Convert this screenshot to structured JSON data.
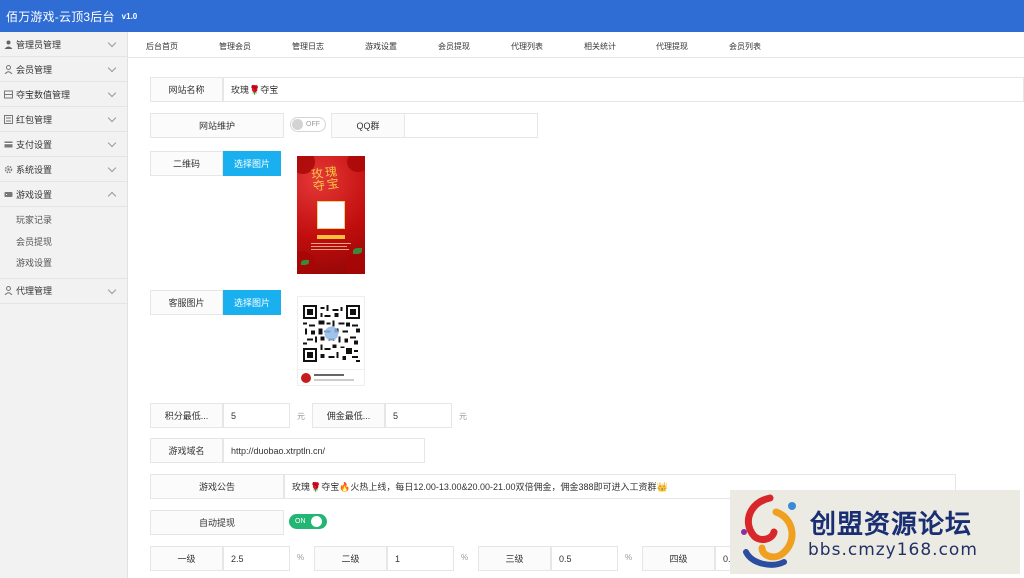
{
  "app": {
    "title": "佰万游戏-云顶3后台",
    "version": "v1.0"
  },
  "sidebar": {
    "items": [
      {
        "label": "管理员管理",
        "icon": "user-icon"
      },
      {
        "label": "会员管理",
        "icon": "person-icon"
      },
      {
        "label": "夺宝数值管理",
        "icon": "database-icon"
      },
      {
        "label": "红包管理",
        "icon": "list-icon"
      },
      {
        "label": "支付设置",
        "icon": "card-icon"
      },
      {
        "label": "系统设置",
        "icon": "gear-icon"
      },
      {
        "label": "游戏设置",
        "icon": "gamepad-icon"
      },
      {
        "label": "代理管理",
        "icon": "agent-icon"
      }
    ],
    "sub_items": [
      "玩家记录",
      "会员提现",
      "游戏设置"
    ]
  },
  "topnav": {
    "tabs": [
      "后台首页",
      "管理会员",
      "管理日志",
      "游戏设置",
      "会员提现",
      "代理列表",
      "相关统计",
      "代理提现",
      "会员列表"
    ]
  },
  "form": {
    "site_name_label": "网站名称",
    "site_name_value": "玫瑰🌹夺宝",
    "maintenance_label": "网站维护",
    "maintenance_toggle": "OFF",
    "qq_label": "QQ群",
    "qq_value": "",
    "qrcode_label": "二维码",
    "choose_image_label": "选择图片",
    "service_image_label": "客服图片",
    "choose_image_label_2": "选择图片",
    "min_points_label": "积分最低...",
    "min_points_value": "5",
    "min_points_unit": "元",
    "min_commission_label": "佣金最低...",
    "min_commission_value": "5",
    "min_commission_unit": "元",
    "game_domain_label": "游戏域名",
    "game_domain_value": "http://duobao.xtrptln.cn/",
    "announcement_label": "游戏公告",
    "announcement_value": "玫瑰🌹夺宝🔥火热上线，每日12.00-13.00&20.00-21.00双倍佣金，佣金388即可进入工资群👑",
    "auto_withdraw_label": "自动提现",
    "auto_withdraw_toggle": "ON",
    "level1_label": "一级",
    "level1_value": "2.5",
    "level2_label": "二级",
    "level2_value": "1",
    "level3_label": "三级",
    "level3_value": "0.5",
    "level4_label": "四级",
    "level4_value": "0.",
    "percent_unit": "%"
  },
  "poster": {
    "title": "玫瑰夺宝"
  },
  "watermark": {
    "line1": "创盟资源论坛",
    "line2": "bbs.cmzy168.com"
  },
  "colors": {
    "header_bg": "#2f6dd5",
    "button_blue": "#1ab0f0",
    "toggle_on": "#22b573"
  }
}
